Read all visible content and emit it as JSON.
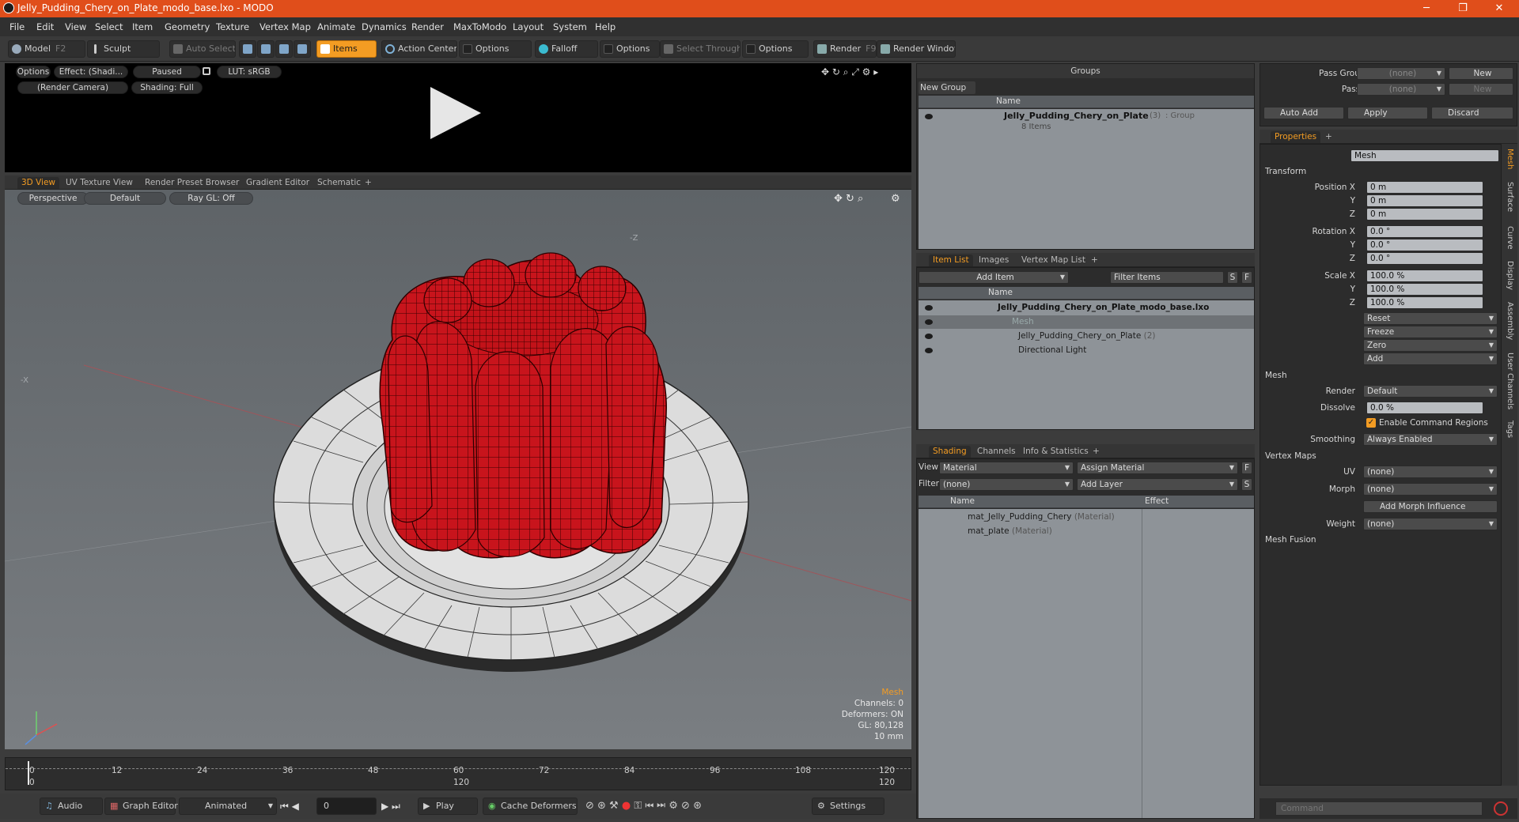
{
  "window": {
    "title": "Jelly_Pudding_Chery_on_Plate_modo_base.lxo - MODO",
    "min": "─",
    "max": "❐",
    "close": "✕"
  },
  "menu": [
    "File",
    "Edit",
    "View",
    "Select",
    "Item",
    "Geometry",
    "Texture",
    "Vertex Map",
    "Animate",
    "Dynamics",
    "Render",
    "MaxToModo",
    "Layout",
    "System",
    "Help"
  ],
  "toolbar": {
    "model": "Model",
    "model_key": "F2",
    "sculpt": "Sculpt",
    "auto_select": "Auto Select",
    "items": "Items",
    "action_center": "Action Center",
    "options1": "Options",
    "falloff": "Falloff",
    "options2": "Options",
    "select_through": "Select Through",
    "options3": "Options",
    "render": "Render",
    "render_key": "F9",
    "render_window": "Render Window"
  },
  "preview": {
    "options": "Options",
    "effect": "Effect: (Shadi...",
    "paused": "Paused",
    "lut": "LUT: sRGB",
    "camera": "(Render Camera)",
    "shading": "Shading: Full"
  },
  "view_tabs": [
    "3D View",
    "UV Texture View",
    "Render Preset Browser",
    "Gradient Editor",
    "Schematic",
    "+"
  ],
  "viewport": {
    "perspective": "Perspective",
    "default": "Default",
    "raygl": "Ray GL: Off",
    "axis_neg_z": "-Z",
    "axis_neg_x": "-X",
    "stats": {
      "mesh": "Mesh",
      "channels": "Channels: 0",
      "deformers": "Deformers: ON",
      "gl": "GL: 80,128",
      "size": "10 mm"
    }
  },
  "timeline": {
    "ticks": [
      "0",
      "12",
      "24",
      "36",
      "48",
      "60",
      "72",
      "84",
      "96",
      "108",
      "120"
    ],
    "sub_ticks": [
      "0",
      "120",
      "120"
    ]
  },
  "bottom": {
    "audio": "Audio",
    "graph_editor": "Graph Editor",
    "animated": "Animated",
    "frame": "0",
    "play": "Play",
    "cache": "Cache Deformers",
    "settings": "Settings"
  },
  "groups": {
    "title": "Groups",
    "new_group": "New Group",
    "col_name": "Name",
    "item_name": "Jelly_Pudding_Chery_on_Plate",
    "item_count": "(3)",
    "item_type": ": Group",
    "item_sub": "8 Items"
  },
  "item_list": {
    "tabs": [
      "Item List",
      "Images",
      "Vertex Map List",
      "+"
    ],
    "add_item": "Add Item",
    "filter": "Filter Items",
    "s": "S",
    "f": "F",
    "col_name": "Name",
    "rows": [
      {
        "label": "Jelly_Pudding_Chery_on_Plate_modo_base.lxo",
        "suffix": ""
      },
      {
        "label": "Mesh",
        "suffix": ""
      },
      {
        "label": "Jelly_Pudding_Chery_on_Plate",
        "suffix": "(2)"
      },
      {
        "label": "Directional Light",
        "suffix": ""
      }
    ]
  },
  "shading": {
    "tabs": [
      "Shading",
      "Channels",
      "Info & Statistics",
      "+"
    ],
    "view_label": "View",
    "view_value": "Material",
    "assign": "Assign Material",
    "f": "F",
    "filter_label": "Filter",
    "filter_value": "(none)",
    "add_layer": "Add Layer",
    "s": "S",
    "col_name": "Name",
    "col_effect": "Effect",
    "rows": [
      {
        "label": "mat_Jelly_Pudding_Chery",
        "type": "(Material)"
      },
      {
        "label": "mat_plate",
        "type": "(Material)"
      }
    ]
  },
  "passes": {
    "pass_groups": "Pass Groups",
    "passes": "Passes",
    "none1": "(none)",
    "none2": "(none)",
    "new1": "New",
    "new2": "New",
    "auto_add": "Auto Add",
    "apply": "Apply",
    "discard": "Discard"
  },
  "properties": {
    "tab": "Properties",
    "plus": "+",
    "name_label": "Name",
    "name_value": "Mesh",
    "transform": "Transform",
    "pos_label": "Position X",
    "pos": [
      "0 m",
      "0 m",
      "0 m"
    ],
    "rot_label": "Rotation X",
    "rot": [
      "0.0 °",
      "0.0 °",
      "0.0 °"
    ],
    "scale_label": "Scale X",
    "scale": [
      "100.0 %",
      "100.0 %",
      "100.0 %"
    ],
    "y": "Y",
    "z": "Z",
    "actions": [
      "Reset",
      "Freeze",
      "Zero",
      "Add"
    ],
    "mesh": "Mesh",
    "render_label": "Render",
    "render_value": "Default",
    "dissolve_label": "Dissolve",
    "dissolve_value": "0.0 %",
    "cmd_regions": "Enable Command Regions",
    "smoothing_label": "Smoothing",
    "smoothing_value": "Always Enabled",
    "vertex_maps": "Vertex Maps",
    "uv_label": "UV",
    "uv_value": "(none)",
    "morph_label": "Morph",
    "morph_value": "(none)",
    "add_morph": "Add Morph Influence",
    "weight_label": "Weight",
    "weight_value": "(none)",
    "mesh_fusion": "Mesh Fusion",
    "side_tabs": [
      "Mesh",
      "Surface",
      "Curve",
      "Display",
      "Assembly",
      "User Channels",
      "Tags"
    ]
  },
  "command": {
    "placeholder": "Command"
  },
  "colors": {
    "accent": "#f39c23",
    "title": "#e04e1b",
    "jelly": "#c8141c"
  }
}
